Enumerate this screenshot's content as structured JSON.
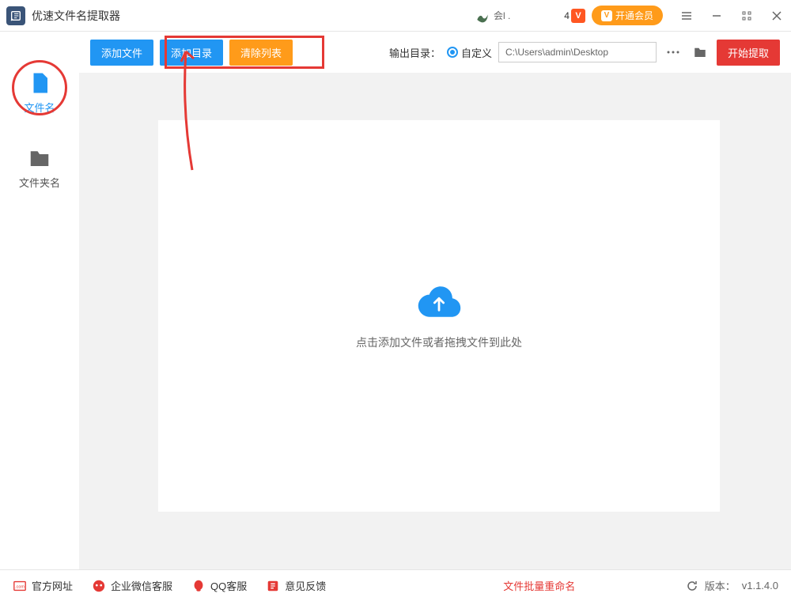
{
  "titlebar": {
    "app_name": "优速文件名提取器",
    "user_name": "会l .",
    "badge_num": "4",
    "vip_label": "开通会员"
  },
  "sidebar": {
    "items": [
      {
        "label": "文件名"
      },
      {
        "label": "文件夹名"
      }
    ]
  },
  "toolbar": {
    "add_file": "添加文件",
    "add_dir": "添加目录",
    "clear_list": "清除列表",
    "output_label": "输出目录：",
    "radio_custom": "自定义",
    "path_value": "C:\\Users\\admin\\Desktop",
    "start_btn": "开始提取"
  },
  "dropzone": {
    "text": "点击添加文件或者拖拽文件到此处"
  },
  "footer": {
    "official": "官方网址",
    "wechat": "企业微信客服",
    "qq": "QQ客服",
    "feedback": "意见反馈",
    "batch_rename": "文件批量重命名",
    "version_label": "版本：",
    "version": "v1.1.4.0"
  }
}
